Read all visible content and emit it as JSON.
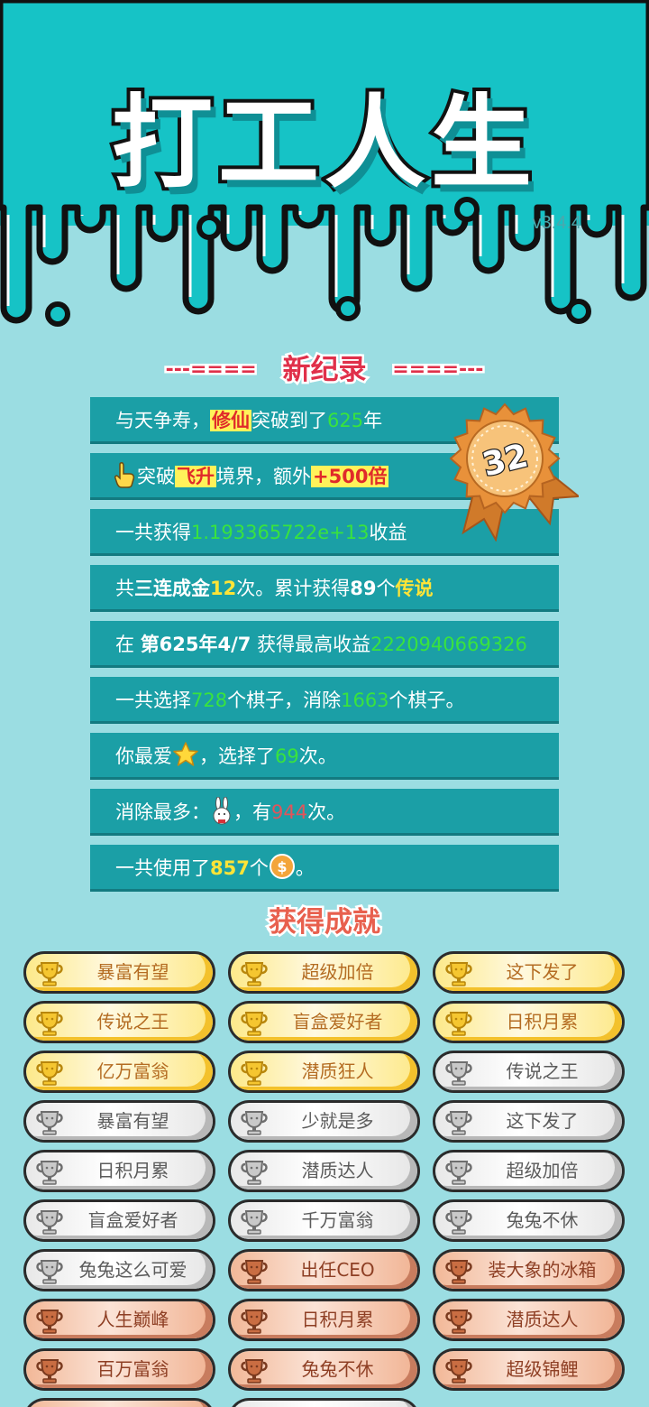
{
  "app": {
    "title": "打工人生",
    "version": "v3.4.4"
  },
  "new_record": {
    "dash_left": "---====",
    "title": "新纪录",
    "dash_right": "====---",
    "badge_value": "32"
  },
  "records": [
    {
      "a": "与天争寿，",
      "b": "修仙",
      "c": "突破到了",
      "d": "625",
      "e": "年"
    },
    {
      "a": "突破",
      "b": "飞升",
      "c": "境界，额外",
      "d": "+500倍"
    },
    {
      "a": "一共获得",
      "b": "1.193365722e+13",
      "c": "收益"
    },
    {
      "a": "共",
      "b": "三连成金",
      "c": "12",
      "d": "次。累计获得",
      "e": "89",
      "f": "个",
      "g": "传说"
    },
    {
      "a": "在 ",
      "b": "第625年4/7",
      "c": " 获得最高收益",
      "d": "2220940669326"
    },
    {
      "a": "一共选择",
      "b": "728",
      "c": "个棋子，消除",
      "d": "1663",
      "e": "个棋子。"
    },
    {
      "a": "你最爱",
      "b": "，选择了",
      "c": "69",
      "d": "次。"
    },
    {
      "a": "消除最多：",
      "b": "，有",
      "c": "944",
      "d": "次。"
    },
    {
      "a": "一共使用了",
      "b": "857",
      "c": "个",
      "d": "。"
    }
  ],
  "achievements_title": "获得成就",
  "achievements": [
    {
      "label": "暴富有望",
      "tier": "gold"
    },
    {
      "label": "超级加倍",
      "tier": "gold"
    },
    {
      "label": "这下发了",
      "tier": "gold"
    },
    {
      "label": "传说之王",
      "tier": "gold"
    },
    {
      "label": "盲盒爱好者",
      "tier": "gold"
    },
    {
      "label": "日积月累",
      "tier": "gold"
    },
    {
      "label": "亿万富翁",
      "tier": "gold"
    },
    {
      "label": "潜质狂人",
      "tier": "gold"
    },
    {
      "label": "传说之王",
      "tier": "silver"
    },
    {
      "label": "暴富有望",
      "tier": "silver"
    },
    {
      "label": "少就是多",
      "tier": "silver"
    },
    {
      "label": "这下发了",
      "tier": "silver"
    },
    {
      "label": "日积月累",
      "tier": "silver"
    },
    {
      "label": "潜质达人",
      "tier": "silver"
    },
    {
      "label": "超级加倍",
      "tier": "silver"
    },
    {
      "label": "盲盒爱好者",
      "tier": "silver"
    },
    {
      "label": "千万富翁",
      "tier": "silver"
    },
    {
      "label": "兔兔不休",
      "tier": "silver"
    },
    {
      "label": "兔兔这么可爱",
      "tier": "silver"
    },
    {
      "label": "出任CEO",
      "tier": "bronze"
    },
    {
      "label": "装大象的冰箱",
      "tier": "bronze"
    },
    {
      "label": "人生巅峰",
      "tier": "bronze"
    },
    {
      "label": "日积月累",
      "tier": "bronze"
    },
    {
      "label": "潜质达人",
      "tier": "bronze"
    },
    {
      "label": "百万富翁",
      "tier": "bronze"
    },
    {
      "label": "兔兔不休",
      "tier": "bronze"
    },
    {
      "label": "超级锦鲤",
      "tier": "bronze"
    },
    {
      "label": "",
      "tier": "bronze"
    },
    {
      "label": "",
      "tier": "silver"
    }
  ],
  "colors": {
    "teal": "#16c3c6",
    "background": "#9bdde2",
    "row": "#1b9fa6",
    "green_value": "#39e33e",
    "yellow_value": "#ffe437",
    "red_value": "#e2545a"
  },
  "icons": {
    "hand": "pointing-hand-icon",
    "star": "star-icon",
    "rabbit": "rabbit-icon",
    "coin": "coin-icon",
    "trophy": "trophy-icon",
    "badge": "rank-badge-icon"
  }
}
